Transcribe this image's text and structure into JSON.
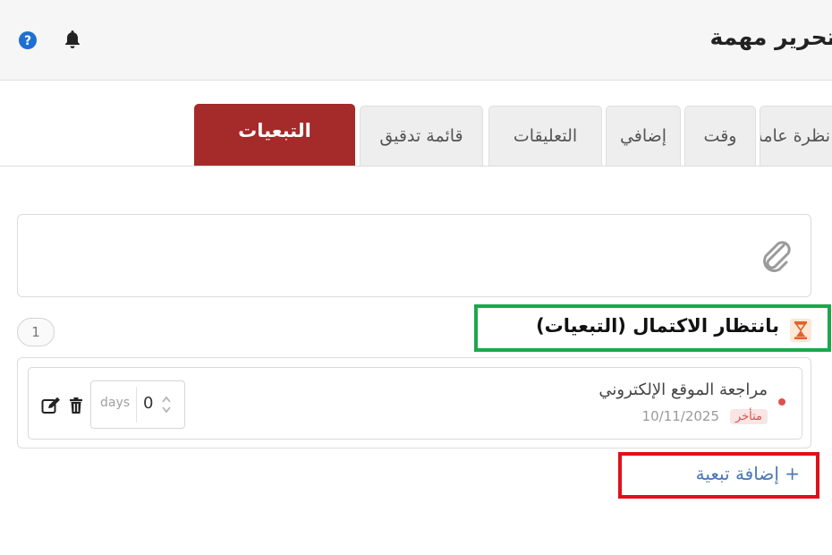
{
  "header": {
    "title": "تحرير مهمة",
    "help_icon": "question-circle-icon",
    "notifications_icon": "bell-icon"
  },
  "tabs": [
    {
      "label": "نظرة عامة"
    },
    {
      "label": "وقت"
    },
    {
      "label": "إضافي"
    },
    {
      "label": "التعليقات"
    },
    {
      "label": "قائمة تدقيق"
    },
    {
      "label": "التبعيات",
      "active": true
    }
  ],
  "attachment": {
    "icon": "paperclip-icon"
  },
  "dependencies": {
    "count": "1",
    "section_title": "بانتظار الاكتمال (التبعيات)",
    "section_icon": "hourglass-icon",
    "items": [
      {
        "title": "مراجعة الموقع الإلكتروني",
        "status": "متأخر",
        "date": "10/11/2025",
        "lag_value": "0",
        "lag_unit": "days"
      }
    ],
    "add_label": "+ إضافة تبعية"
  },
  "colors": {
    "active_tab": "#a52a2a",
    "link": "#4a78b6",
    "highlight_green": "#1aa84a",
    "highlight_red": "#e0101a",
    "overdue": "#d9534f"
  }
}
